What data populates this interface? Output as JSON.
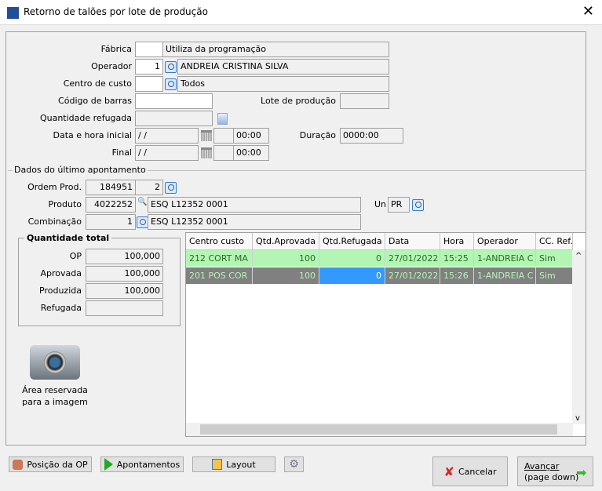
{
  "window": {
    "title": "Retorno de talões por lote de produção",
    "close": "✕"
  },
  "form": {
    "fabrica": {
      "label": "Fábrica",
      "code": "",
      "desc": "Utiliza da programação"
    },
    "operador": {
      "label": "Operador",
      "code": "1",
      "desc": "ANDREIA CRISTINA SILVA"
    },
    "centro": {
      "label": "Centro de custo",
      "code": "",
      "desc": "Todos"
    },
    "codigo": {
      "label": "Código de barras",
      "value": ""
    },
    "lote": {
      "label": "Lote de produção",
      "value": ""
    },
    "qtd_ref": {
      "label": "Quantidade refugada",
      "value": ""
    },
    "inicial": {
      "label": "Data e hora inicial",
      "date": " /  /",
      "time": "00:00"
    },
    "duracao": {
      "label": "Duração",
      "value": "0000:00"
    },
    "final": {
      "label": "Final",
      "date": " /  /",
      "time": "00:00"
    }
  },
  "ultimo": {
    "title": "Dados do último apontamento",
    "ordem": {
      "label": "Ordem Prod.",
      "value": "184951",
      "seq": "2"
    },
    "produto": {
      "label": "Produto",
      "value": "4022252",
      "desc": "ESQ L12352 0001"
    },
    "un": {
      "label": "Un",
      "value": "PR"
    },
    "combinacao": {
      "label": "Combinação",
      "value": "1",
      "desc": "ESQ L12352 0001"
    }
  },
  "totais": {
    "title": "Quantidade total",
    "op": {
      "label": "OP",
      "value": "100,000"
    },
    "aprovada": {
      "label": "Aprovada",
      "value": "100,000"
    },
    "produzida": {
      "label": "Produzida",
      "value": "100,000"
    },
    "refugada": {
      "label": "Refugada",
      "value": ""
    }
  },
  "image_area": {
    "line1": "Área reservada",
    "line2": "para a imagem"
  },
  "table": {
    "columns": [
      "Centro custo",
      "Qtd.Aprovada",
      "Qtd.Refugada",
      "Data",
      "Hora",
      "Operador",
      "CC. Ref."
    ],
    "rows": [
      [
        "212 CORT MA",
        "100",
        "0",
        "27/01/2022",
        "15:25",
        "1-ANDREIA C",
        "Sim"
      ],
      [
        "201 POS COR",
        "100",
        "0",
        "27/01/2022",
        "15:26",
        "1-ANDREIA C",
        "Sim"
      ]
    ]
  },
  "buttons": {
    "posicao": "Posição da OP",
    "apontamentos": "Apontamentos",
    "layout": "Layout",
    "cancelar": "Cancelar",
    "avancar1": "Avançar",
    "avancar2": "(page down)"
  },
  "colors": {
    "row_green": "#b3f5b3",
    "row_selected": "#808080",
    "cell_focus": "#3399ff"
  }
}
